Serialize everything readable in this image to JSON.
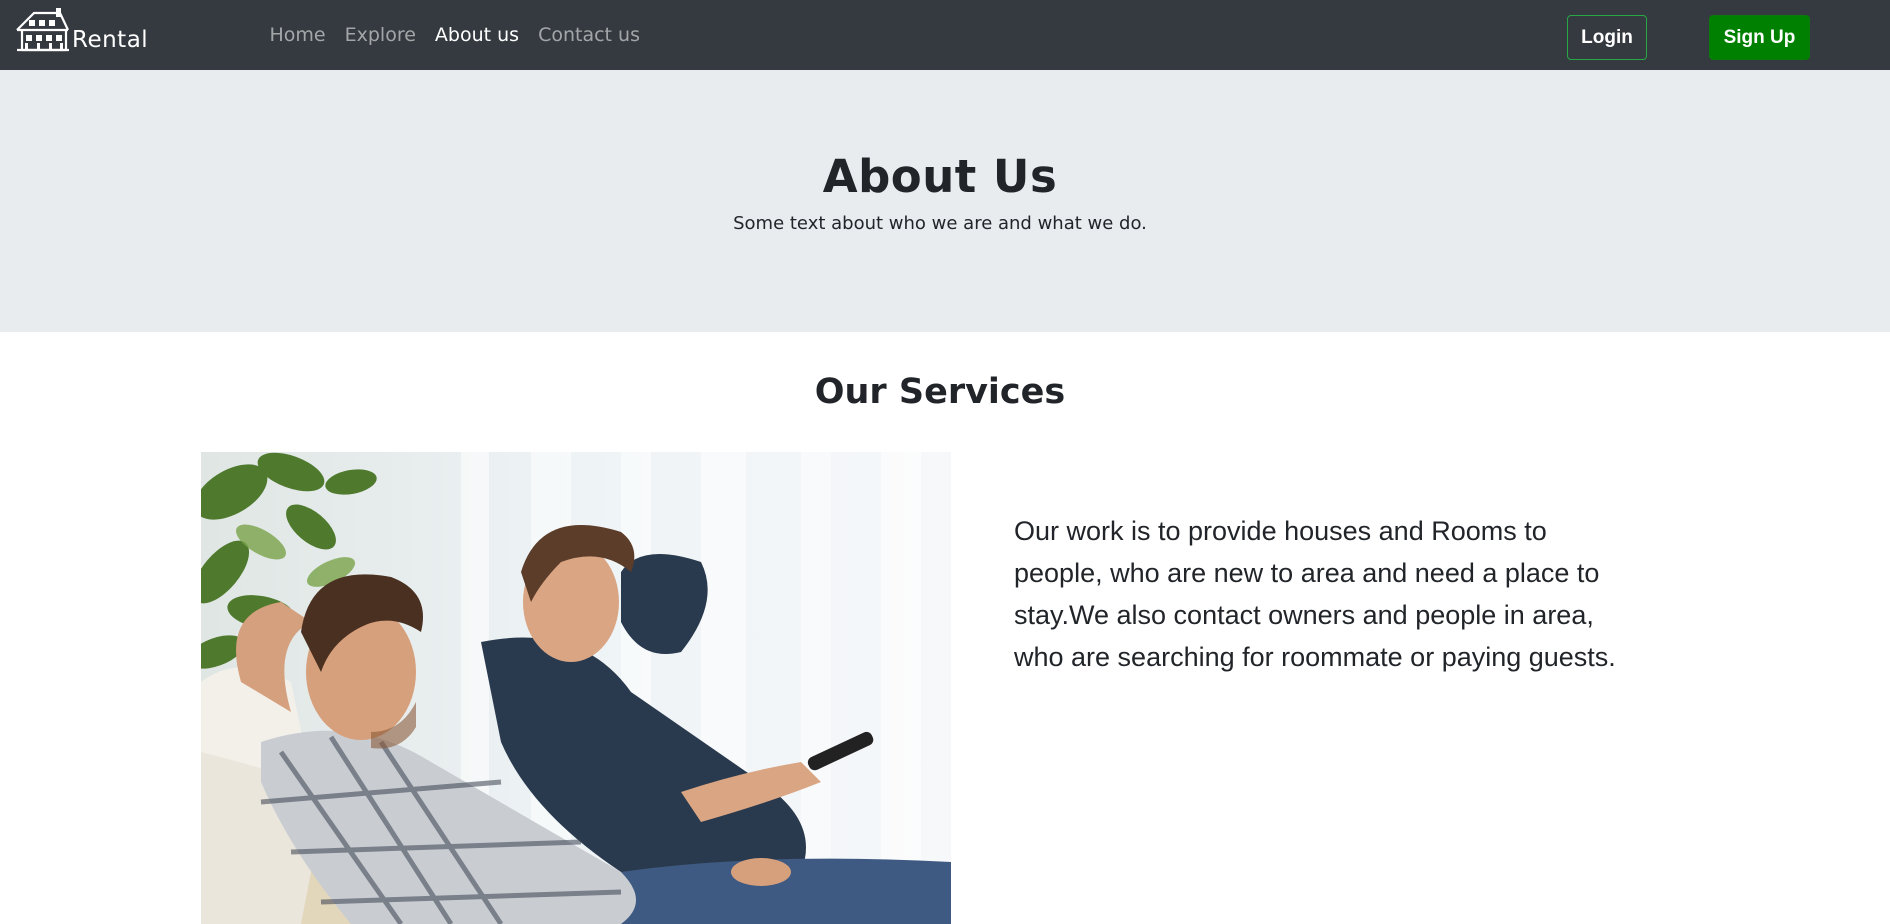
{
  "brand": {
    "name": "Rental",
    "icon": "house-logo-icon"
  },
  "nav": {
    "items": [
      {
        "label": "Home",
        "active": false
      },
      {
        "label": "Explore",
        "active": false
      },
      {
        "label": "About us",
        "active": true
      },
      {
        "label": "Contact us",
        "active": false
      }
    ]
  },
  "auth": {
    "login_label": "Login",
    "signup_label": "Sign Up"
  },
  "hero": {
    "title": "About Us",
    "subtitle": "Some text about who we are and what we do."
  },
  "services": {
    "title": "Our Services",
    "image_icon": "two-men-relaxing-on-couch-photo",
    "description": "Our work is to provide houses and Rooms to people, who are new to area and need a place to stay.We also contact owners and people in area, who are searching for roommate or paying guests."
  },
  "colors": {
    "navbar_bg": "#343a40",
    "hero_bg": "#e9ecef",
    "signup_bg": "#008000",
    "login_border": "#28a745"
  }
}
